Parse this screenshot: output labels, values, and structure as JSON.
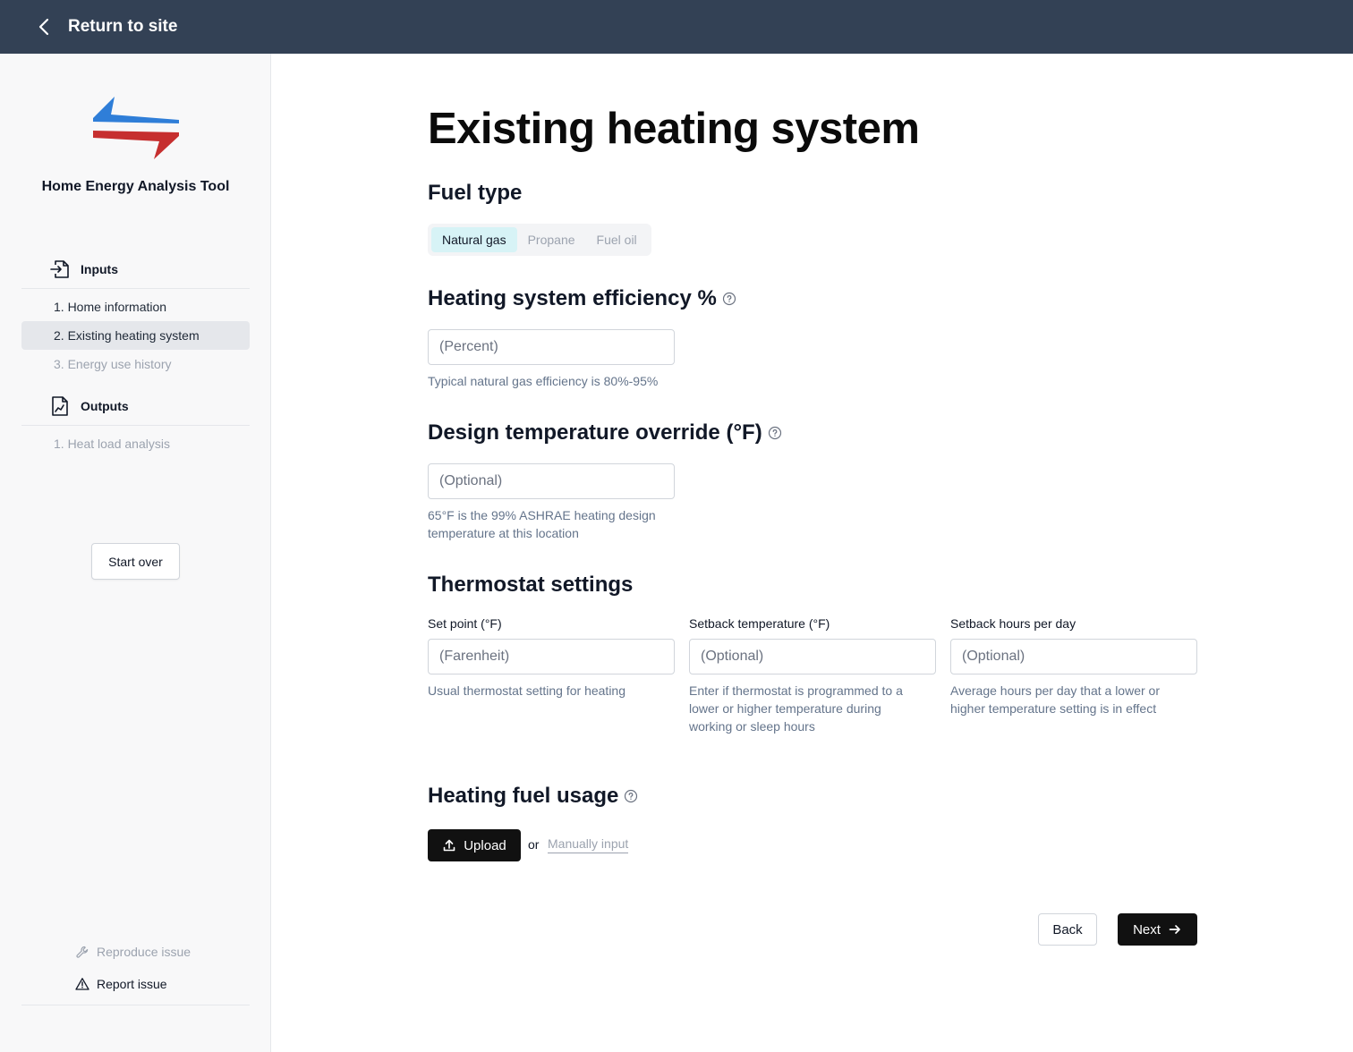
{
  "topbar": {
    "back_label": "Return to site",
    "back_icon": "chevron-left-icon"
  },
  "sidebar": {
    "logo_icon": "arrows-logo",
    "app_title": "Home Energy Analysis Tool",
    "inputs": {
      "heading": "Inputs",
      "icon": "file-import-icon",
      "items": [
        {
          "label": "1. Home information",
          "state": "done"
        },
        {
          "label": "2. Existing heating system",
          "state": "active"
        },
        {
          "label": "3. Energy use history",
          "state": "disabled"
        }
      ]
    },
    "outputs": {
      "heading": "Outputs",
      "icon": "file-chart-icon",
      "items": [
        {
          "label": "1. Heat load analysis",
          "state": "disabled"
        }
      ]
    },
    "start_over_label": "Start over",
    "reproduce_issue_label": "Reproduce issue",
    "report_issue_label": "Report issue"
  },
  "main": {
    "title": "Existing heating system",
    "fuel_type": {
      "heading": "Fuel type",
      "options": [
        "Natural gas",
        "Propane",
        "Fuel oil"
      ],
      "selected": "Natural gas"
    },
    "efficiency": {
      "heading": "Heating system efficiency %",
      "placeholder": "(Percent)",
      "help": "Typical natural gas efficiency is 80%-95%"
    },
    "design_temp": {
      "heading": "Design temperature override (°F)",
      "placeholder": "(Optional)",
      "help_line1": "65°F is the 99% ASHRAE heating design",
      "help_line2": "temperature at this location"
    },
    "thermostat": {
      "heading": "Thermostat settings",
      "set_point": {
        "label": "Set point (°F)",
        "placeholder": "(Farenheit)",
        "help": "Usual thermostat setting for heating"
      },
      "setback_temp": {
        "label": "Setback temperature (°F)",
        "placeholder": "(Optional)",
        "help_line1": "Enter if thermostat is programmed to a",
        "help_line2": "lower or higher temperature during",
        "help_line3": "working or sleep hours"
      },
      "setback_hours": {
        "label": "Setback hours per day",
        "placeholder": "(Optional)",
        "help_line1": "Average hours per day that a lower or",
        "help_line2": "higher temperature setting is in effect"
      }
    },
    "fuel_usage": {
      "heading": "Heating fuel usage",
      "upload_label": "Upload",
      "or_text": "or",
      "manual_label": "Manually input"
    },
    "back_label": "Back",
    "next_label": "Next"
  },
  "colors": {
    "topbar_bg": "#334155",
    "sidebar_bg": "#f8f8f9",
    "logo_blue": "#2f7ed8",
    "logo_red": "#c62f2f",
    "selected_segment": "#d7f3f6",
    "primary_button": "#111111",
    "help_text": "#64748b"
  }
}
